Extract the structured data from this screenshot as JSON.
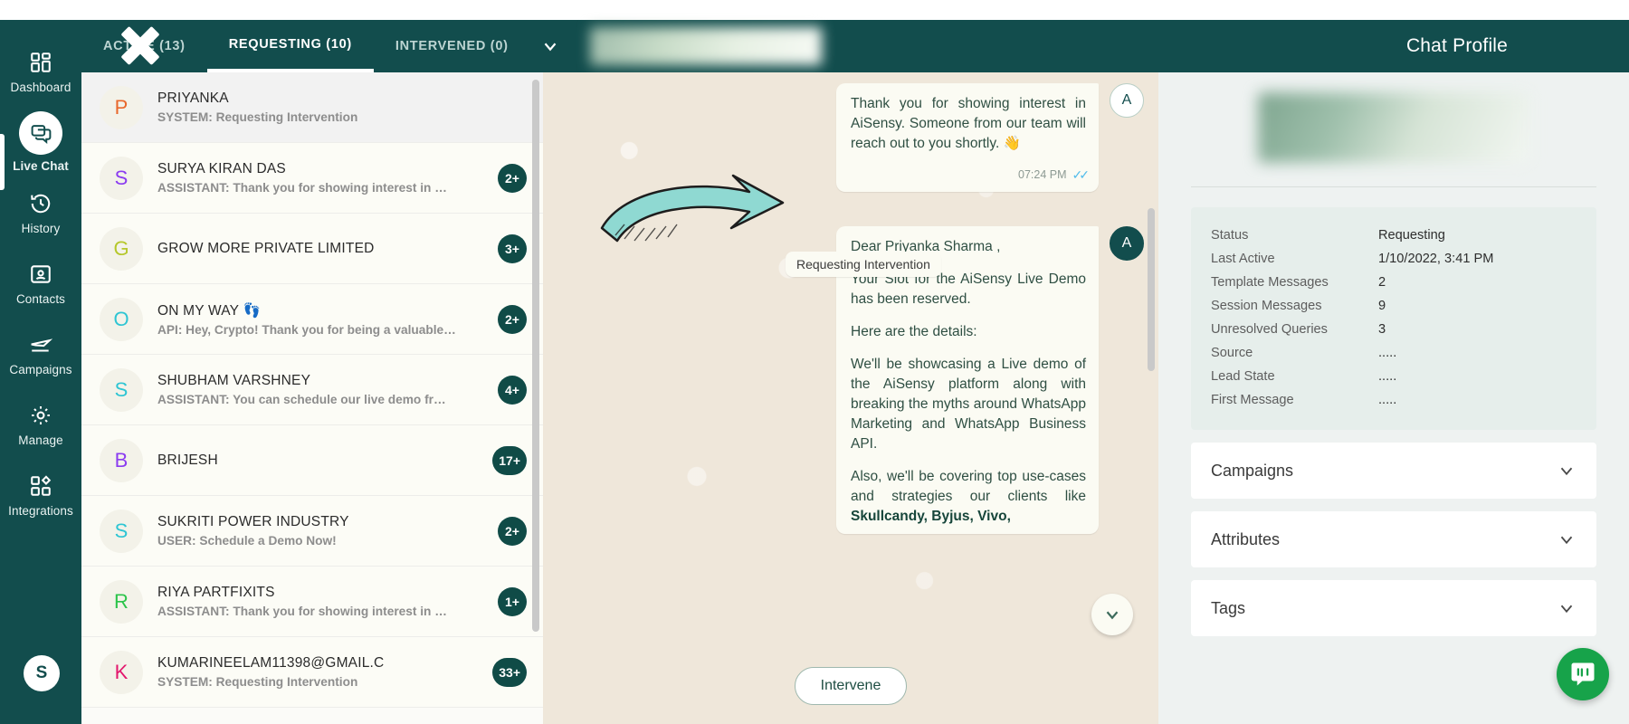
{
  "sidebar": {
    "items": [
      {
        "label": "Dashboard",
        "icon": "grid-icon",
        "active": false
      },
      {
        "label": "Live Chat",
        "icon": "chat-icon",
        "active": true
      },
      {
        "label": "History",
        "icon": "history-clock-icon",
        "active": false
      },
      {
        "label": "Contacts",
        "icon": "contact-card-icon",
        "active": false
      },
      {
        "label": "Campaigns",
        "icon": "plane-icon",
        "active": false
      },
      {
        "label": "Manage",
        "icon": "gear-icon",
        "active": false
      },
      {
        "label": "Integrations",
        "icon": "integrations-icon",
        "active": false
      }
    ],
    "avatar_initial": "S"
  },
  "topbar": {
    "tabs": [
      {
        "label": "ACTIVE (13)",
        "active": false
      },
      {
        "label": "REQUESTING (10)",
        "active": true
      },
      {
        "label": "INTERVENED (0)",
        "active": false
      }
    ],
    "caret_icon": "chevron-down-icon",
    "search_placeholder": "",
    "search_value": "",
    "profile_title": "Chat Profile"
  },
  "chat_list": [
    {
      "initial": "P",
      "color": "#e8682c",
      "name": "PRIYANKA",
      "preview": "SYSTEM: Requesting Intervention",
      "badge": "",
      "selected": true
    },
    {
      "initial": "S",
      "color": "#8b3cf0",
      "name": "SURYA KIRAN DAS",
      "preview": "ASSISTANT: Thank you for showing interest in …",
      "badge": "2+",
      "selected": false
    },
    {
      "initial": "G",
      "color": "#b5c72a",
      "name": "GROW MORE PRIVATE LIMITED",
      "preview": "",
      "badge": "3+",
      "selected": false
    },
    {
      "initial": "O",
      "color": "#2ec5d3",
      "name": "ON MY WAY 👣",
      "preview": "API: Hey, Crypto! Thank you for being a valuable…",
      "badge": "2+",
      "selected": false
    },
    {
      "initial": "S",
      "color": "#2ec5d3",
      "name": "SHUBHAM VARSHNEY",
      "preview": "ASSISTANT: You can schedule our live demo fr…",
      "badge": "4+",
      "selected": false
    },
    {
      "initial": "B",
      "color": "#8b3cf0",
      "name": "BRIJESH",
      "preview": "",
      "badge": "17+",
      "selected": false
    },
    {
      "initial": "S",
      "color": "#2ec5d3",
      "name": "SUKRITI POWER INDUSTRY",
      "preview": "USER: Schedule a Demo Now!",
      "badge": "2+",
      "selected": false
    },
    {
      "initial": "R",
      "color": "#2bc44a",
      "name": "RIYA PARTFIXITS",
      "preview": "ASSISTANT: Thank you for showing interest in …",
      "badge": "1+",
      "selected": false
    },
    {
      "initial": "K",
      "color": "#e3176d",
      "name": "KUMARINEELAM11398@GMAIL.C",
      "preview": "SYSTEM: Requesting Intervention",
      "badge": "33+",
      "selected": false
    }
  ],
  "conversation": {
    "messages": [
      {
        "id": "msg-1",
        "avatar": "A",
        "avatar_filled": false,
        "paragraphs": [
          "Thank you for showing interest in AiSensy. Someone from our team will reach out to you shortly. 👋"
        ],
        "time": "07:24 PM",
        "ticks": "✓✓"
      },
      {
        "id": "msg-2",
        "avatar": "A",
        "avatar_filled": true,
        "paragraphs": [
          "Dear Priyanka Sharma ,",
          "Your Slot for the AiSensy Live Demo has been reserved.",
          "Here are the details:",
          "We'll be showcasing a Live demo of the AiSensy platform along with breaking the myths around WhatsApp Marketing and WhatsApp Business API."
        ],
        "last_paragraph_prefix": "Also, we'll be covering top use-cases and strategies our clients like ",
        "brands": "Skullcandy, Byjus, Vivo,",
        "time": "",
        "ticks": ""
      }
    ],
    "system_chip": "Requesting Intervention",
    "annotation_icon": "curved-arrow-annotation",
    "scroll_down_icon": "chevron-down-icon",
    "intervene_label": "Intervene"
  },
  "profile_panel": {
    "details": [
      {
        "key": "Status",
        "value": "Requesting"
      },
      {
        "key": "Last Active",
        "value": "1/10/2022, 3:41 PM"
      },
      {
        "key": "Template Messages",
        "value": "2"
      },
      {
        "key": "Session Messages",
        "value": "9"
      },
      {
        "key": "Unresolved Queries",
        "value": "3"
      },
      {
        "key": "Source",
        "value": "....."
      },
      {
        "key": "Lead State",
        "value": "....."
      },
      {
        "key": "First Message",
        "value": "....."
      }
    ],
    "accordions": [
      {
        "label": "Campaigns",
        "icon": "chevron-down-icon"
      },
      {
        "label": "Attributes",
        "icon": "chevron-down-icon"
      },
      {
        "label": "Tags",
        "icon": "chevron-down-icon"
      }
    ]
  },
  "overlays": {
    "cursor_icon": "close-x-cursor",
    "intercom_icon": "intercom-messenger-icon"
  },
  "colors": {
    "brand_dark": "#124D4D",
    "badge": "#104b47",
    "chat_bg": "#efe7da",
    "bubble": "#fbfbf3",
    "panel": "#eef2f1",
    "intercom_green": "#17a34a"
  }
}
